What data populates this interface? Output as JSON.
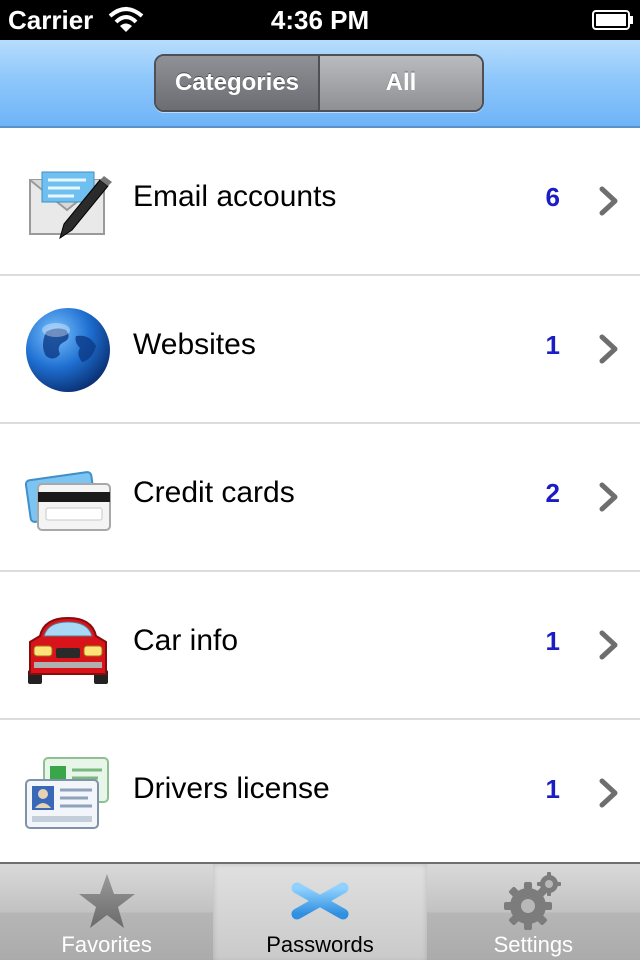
{
  "status_bar": {
    "carrier": "Carrier",
    "time": "4:36 PM"
  },
  "nav": {
    "segments": [
      {
        "label": "Categories",
        "selected": true
      },
      {
        "label": "All",
        "selected": false
      }
    ]
  },
  "list": {
    "rows": [
      {
        "label": "Email accounts",
        "count": "6",
        "icon": "email-icon"
      },
      {
        "label": "Websites",
        "count": "1",
        "icon": "globe-icon"
      },
      {
        "label": "Credit cards",
        "count": "2",
        "icon": "credit-card-icon"
      },
      {
        "label": "Car info",
        "count": "1",
        "icon": "car-icon"
      },
      {
        "label": "Drivers license",
        "count": "1",
        "icon": "id-card-icon"
      }
    ]
  },
  "tab_bar": {
    "tabs": [
      {
        "label": "Favorites",
        "icon": "star-icon",
        "active": false
      },
      {
        "label": "Passwords",
        "icon": "asterisk-icon",
        "active": true
      },
      {
        "label": "Settings",
        "icon": "gear-icon",
        "active": false
      }
    ]
  },
  "colors": {
    "count": "#1c1cc4",
    "nav_accent": "#8ec7fb",
    "active_tab_icon": "#4aa8f0"
  }
}
